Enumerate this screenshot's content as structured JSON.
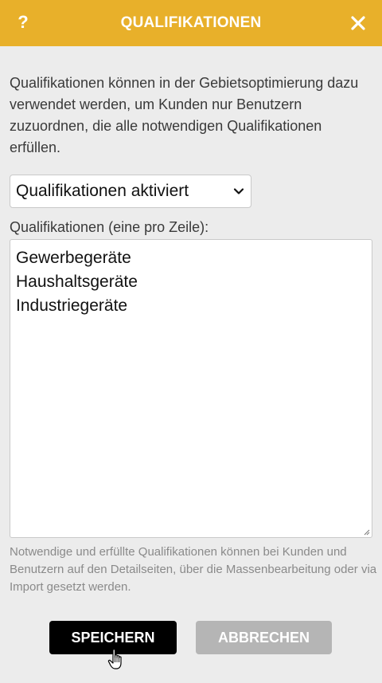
{
  "header": {
    "title": "QUALIFIKATIONEN",
    "help_glyph": "?",
    "close_icon": "close-icon",
    "background": "#e8b02a"
  },
  "description": "Qualifikationen können in der Gebietsoptimierung dazu verwendet werden, um Kunden nur Benutzern zuzuordnen, die alle notwendigen Qualifikationen erfüllen.",
  "mode_select": {
    "value": "Qualifikationen aktiviert"
  },
  "qualifications": {
    "label": "Qualifikationen (eine pro Zeile):",
    "lines": [
      "Gewerbegeräte",
      "Haushaltsgeräte",
      "Industriegeräte"
    ]
  },
  "hint": "Notwendige und erfüllte Qualifikationen können bei Kunden und Benutzern auf den Detailseiten, über die Massenbearbeitung oder via Import gesetzt werden.",
  "buttons": {
    "save_label": "SPEICHERN",
    "cancel_label": "ABBRECHEN"
  }
}
